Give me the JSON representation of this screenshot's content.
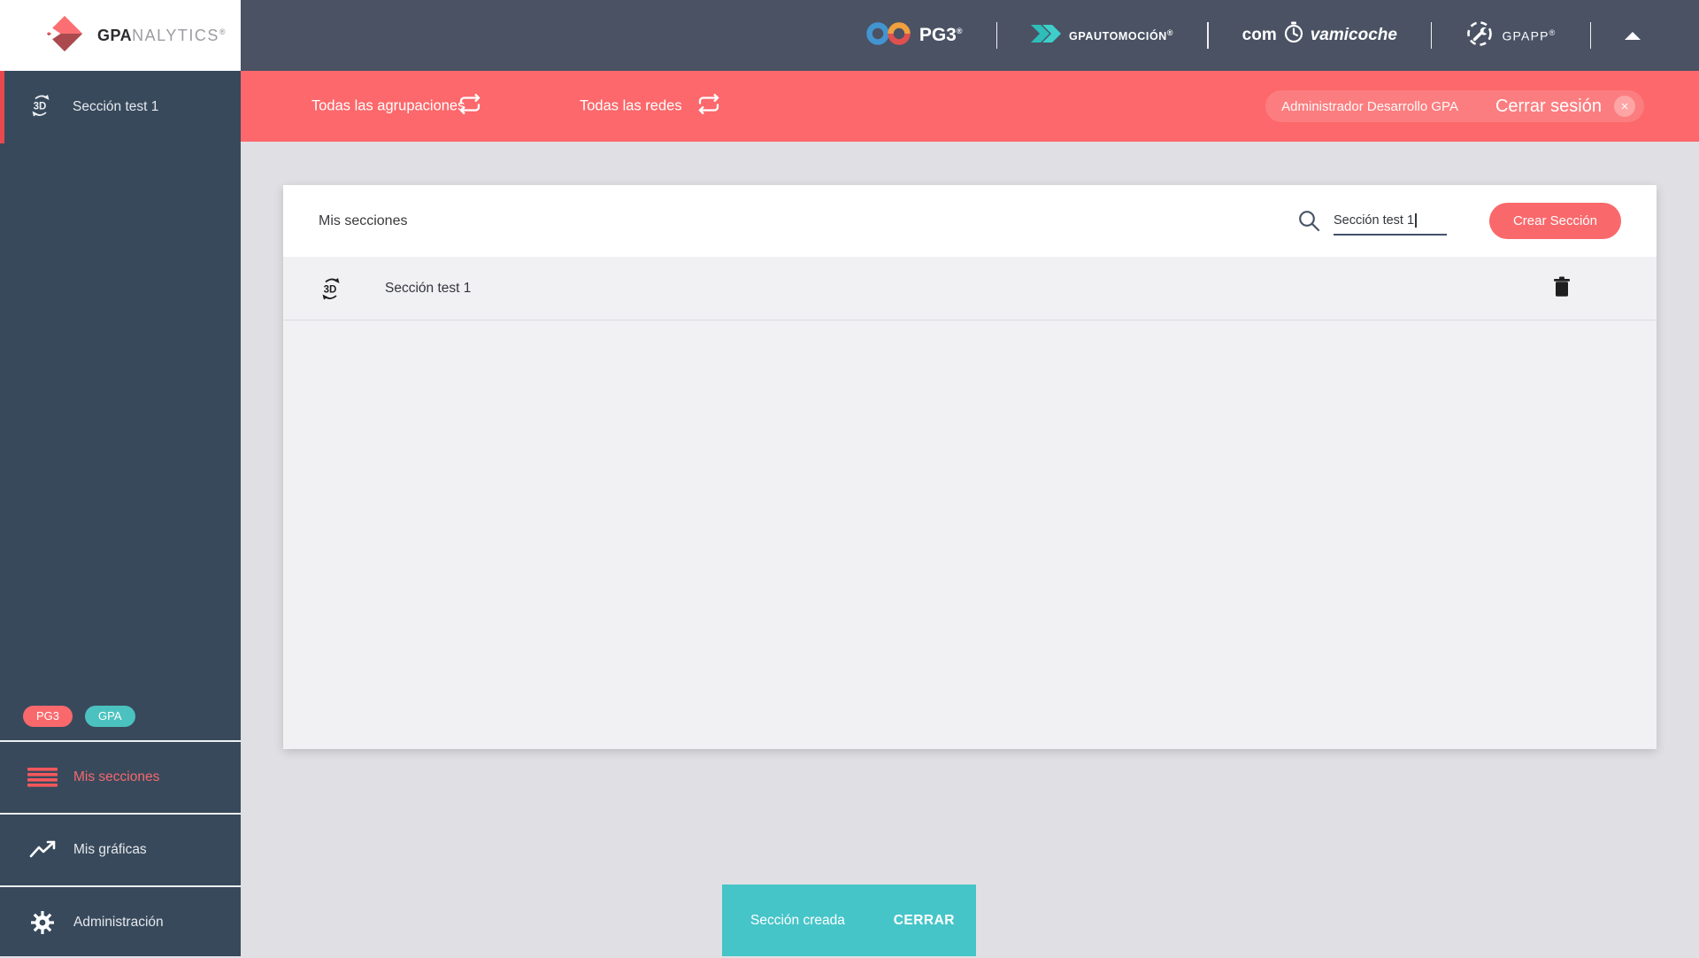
{
  "colors": {
    "accent": "#fc686b",
    "accent_dark": "#e8494e",
    "teal": "#46c5c9",
    "header_bg": "#4a5264",
    "sidebar_bg": "#38495c",
    "page_bg": "#e0e0e4"
  },
  "logo": {
    "bold": "GPA",
    "light": "NALYTICS",
    "reg": "®"
  },
  "header": {
    "pg3": {
      "label": "PG3",
      "reg": "®"
    },
    "gpautomocion": {
      "label": "GPAUTOMOCIÓN",
      "reg": "®"
    },
    "comprovamicoche": {
      "left": "com",
      "right": "vamicoche"
    },
    "gpapp": {
      "label": "GPAPP",
      "reg": "®"
    }
  },
  "filterbar": {
    "groupings": "Todas las agrupaciones",
    "networks": "Todas las redes",
    "user": "Administrador Desarrollo GPA",
    "logout": "Cerrar sesión",
    "close_symbol": "×"
  },
  "sidebar": {
    "section": {
      "label": "Sección test 1"
    },
    "badges": [
      {
        "label": "PG3"
      },
      {
        "label": "GPA"
      }
    ],
    "menu": [
      {
        "label": "Mis secciones",
        "active": true
      },
      {
        "label": "Mis gráficas",
        "active": false
      },
      {
        "label": "Administración",
        "active": false
      }
    ]
  },
  "main": {
    "title": "Mis secciones",
    "search_value": "Sección test 1",
    "create_label": "Crear Sección",
    "rows": [
      {
        "label": "Sección test 1"
      }
    ]
  },
  "toast": {
    "message": "Sección creada",
    "action": "CERRAR"
  }
}
